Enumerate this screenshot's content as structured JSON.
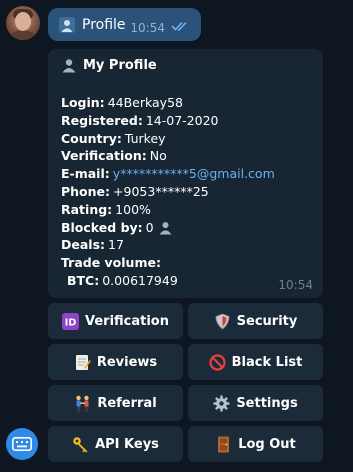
{
  "colors": {
    "background": "#0e1621",
    "outgoing_bubble": "#2b5278",
    "incoming_bubble": "#182533",
    "link": "#6ab2f2",
    "keyboard_button": "#1c2b3a",
    "accent": "#2f8ae6"
  },
  "sent_message": {
    "icon": "bust-in-silhouette-icon",
    "text": "Profile",
    "time": "10:54",
    "status_icon": "double-check-icon"
  },
  "profile": {
    "title_icon": "bust-in-silhouette-icon",
    "title": "My Profile",
    "fields": {
      "login": {
        "label": "Login:",
        "value": "44Berkay58"
      },
      "registered": {
        "label": "Registered:",
        "value": "14-07-2020"
      },
      "country": {
        "label": "Country:",
        "value": "Turkey"
      },
      "verification": {
        "label": "Verification:",
        "value": "No"
      },
      "email": {
        "label": "E-mail:",
        "value": "y***********5@gmail.com"
      },
      "phone": {
        "label": "Phone:",
        "value": "+9053******25"
      },
      "rating": {
        "label": "Rating:",
        "value": "100%"
      },
      "blocked_by": {
        "label": "Blocked by:",
        "value": "0"
      },
      "deals": {
        "label": "Deals:",
        "value": "17"
      },
      "trade_volume": {
        "label": "Trade volume:"
      },
      "btc": {
        "label": "BTC:",
        "value": "0.00617949"
      }
    },
    "time": "10:54"
  },
  "keyboard": {
    "verification": {
      "icon": "id-icon",
      "label": "Verification"
    },
    "security": {
      "icon": "shield-icon",
      "label": "Security"
    },
    "reviews": {
      "icon": "memo-icon",
      "label": "Reviews"
    },
    "black_list": {
      "icon": "prohibited-icon",
      "label": "Black List"
    },
    "referral": {
      "icon": "people-holding-hands-icon",
      "label": "Referral"
    },
    "settings": {
      "icon": "gear-icon",
      "label": "Settings"
    },
    "api_keys": {
      "icon": "key-icon",
      "label": "API Keys"
    },
    "log_out": {
      "icon": "door-icon",
      "label": "Log Out"
    }
  },
  "bot_menu_icon": "keyboard-icon"
}
